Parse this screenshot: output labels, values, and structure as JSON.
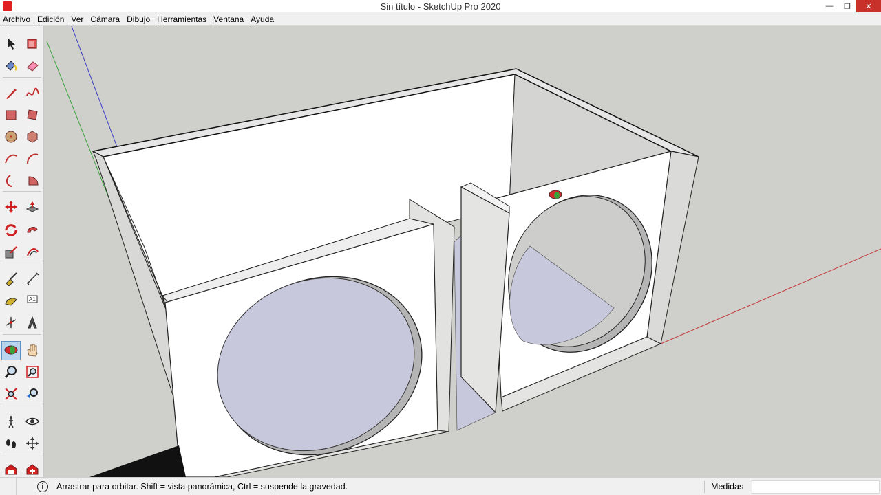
{
  "window": {
    "title": "Sin título - SketchUp Pro 2020"
  },
  "menu": [
    "Archivo",
    "Edición",
    "Ver",
    "Cámara",
    "Dibujo",
    "Herramientas",
    "Ventana",
    "Ayuda"
  ],
  "tools": [
    {
      "name": "select-tool",
      "icon": "arrow-icon"
    },
    {
      "name": "make-component-tool",
      "icon": "component-icon"
    },
    {
      "name": "paint-bucket-tool",
      "icon": "paint-bucket-icon"
    },
    {
      "name": "eraser-tool",
      "icon": "eraser-icon"
    },
    {
      "name": "line-tool",
      "icon": "pencil-icon"
    },
    {
      "name": "freehand-tool",
      "icon": "freehand-icon"
    },
    {
      "name": "rectangle-tool",
      "icon": "rectangle-icon"
    },
    {
      "name": "rotated-rectangle-tool",
      "icon": "rotated-rectangle-icon"
    },
    {
      "name": "circle-tool",
      "icon": "circle-icon"
    },
    {
      "name": "polygon-tool",
      "icon": "polygon-icon"
    },
    {
      "name": "arc-tool",
      "icon": "arc-icon"
    },
    {
      "name": "two-point-arc-tool",
      "icon": "two-point-arc-icon"
    },
    {
      "name": "three-point-arc-tool",
      "icon": "three-point-arc-icon"
    },
    {
      "name": "pie-tool",
      "icon": "pie-icon"
    },
    {
      "name": "move-tool",
      "icon": "move-icon"
    },
    {
      "name": "push-pull-tool",
      "icon": "push-pull-icon"
    },
    {
      "name": "rotate-tool",
      "icon": "rotate-icon"
    },
    {
      "name": "follow-me-tool",
      "icon": "follow-me-icon"
    },
    {
      "name": "scale-tool",
      "icon": "scale-icon"
    },
    {
      "name": "offset-tool",
      "icon": "offset-icon"
    },
    {
      "name": "tape-measure-tool",
      "icon": "tape-measure-icon"
    },
    {
      "name": "dimension-tool",
      "icon": "dimension-icon"
    },
    {
      "name": "protractor-tool",
      "icon": "protractor-icon"
    },
    {
      "name": "text-tool",
      "icon": "text-icon"
    },
    {
      "name": "axes-tool",
      "icon": "axes-icon"
    },
    {
      "name": "3d-text-tool",
      "icon": "3d-text-icon"
    },
    {
      "name": "orbit-tool",
      "icon": "orbit-icon"
    },
    {
      "name": "pan-tool",
      "icon": "hand-icon"
    },
    {
      "name": "zoom-tool",
      "icon": "zoom-icon"
    },
    {
      "name": "zoom-window-tool",
      "icon": "zoom-window-icon"
    },
    {
      "name": "zoom-extents-tool",
      "icon": "zoom-extents-icon"
    },
    {
      "name": "previous-view-tool",
      "icon": "previous-view-icon"
    },
    {
      "name": "position-camera-tool",
      "icon": "position-camera-icon"
    },
    {
      "name": "look-around-tool",
      "icon": "eye-icon"
    },
    {
      "name": "walk-tool",
      "icon": "footprints-icon"
    },
    {
      "name": "section-plane-tool",
      "icon": "section-plane-icon"
    },
    {
      "name": "warehouse-tool",
      "icon": "warehouse-icon"
    },
    {
      "name": "extension-warehouse-tool",
      "icon": "extension-warehouse-icon"
    }
  ],
  "active_tool": "orbit-tool",
  "status": {
    "hint": "Arrastrar para orbitar. Shift = vista panorámica, Ctrl = suspende la gravedad.",
    "measure_label": "Medidas",
    "measure_value": ""
  },
  "colors": {
    "background": "#cfcfcb",
    "face": "#ffffff",
    "face_back": "#d6d6d4",
    "axis_red": "#c43a3a",
    "axis_green": "#3aa43a",
    "axis_blue": "#3a3ac4",
    "speaker_fill": "#c8c8dd"
  }
}
